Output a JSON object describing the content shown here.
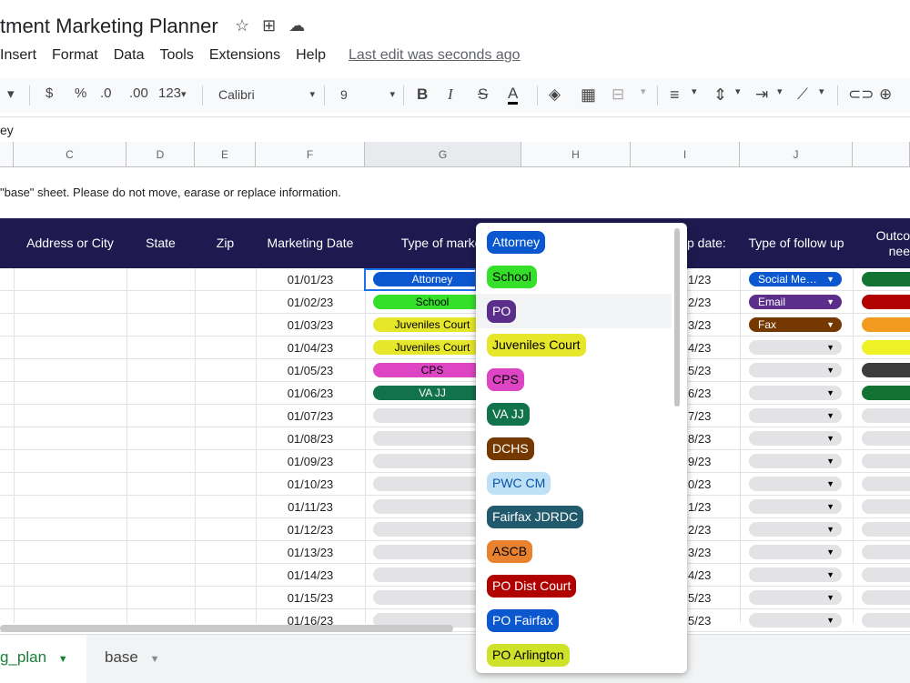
{
  "app": {
    "title": "tment Marketing Planner",
    "menus": [
      "Insert",
      "Format",
      "Data",
      "Tools",
      "Extensions",
      "Help"
    ],
    "last_edit": "Last edit was seconds ago"
  },
  "toolbar": {
    "currency": "$",
    "percent": "%",
    "dec_less": ".0",
    "dec_more": ".00",
    "num_format": "123",
    "font": "Calibri",
    "font_size": "9",
    "bold": "B",
    "italic": "I",
    "strike": "S",
    "text_color": "A"
  },
  "formula_bar": {
    "content": "ey"
  },
  "columns": [
    "C",
    "D",
    "E",
    "F",
    "G",
    "H",
    "I",
    "J"
  ],
  "note": "\"base\" sheet. Please do not move, earase or replace information.",
  "headers": {
    "address": "Address or City",
    "state": "State",
    "zip": "Zip",
    "marketing_date": "Marketing Date",
    "type_market": "Type of market",
    "followup_date": "p date:",
    "type_followup": "Type of follow up",
    "outcome_1": "Outco",
    "outcome_2": "nee"
  },
  "rows": [
    {
      "date": "01/01/23",
      "type": "Attorney",
      "type_color": "#0b57d0",
      "type_text": "#ffffff",
      "fdate": "1/23",
      "follow": "Social Me…",
      "follow_color": "#0b57d0",
      "follow_text": "#ffffff",
      "outcome_color": "#137333"
    },
    {
      "date": "01/02/23",
      "type": "School",
      "type_color": "#35e02a",
      "type_text": "#000000",
      "fdate": "2/23",
      "follow": "Email",
      "follow_color": "#5b2e8c",
      "follow_text": "#ffffff",
      "outcome_color": "#b10202"
    },
    {
      "date": "01/03/23",
      "type": "Juveniles Court",
      "type_color": "#e6e62a",
      "type_text": "#000000",
      "fdate": "3/23",
      "follow": "Fax",
      "follow_color": "#753800",
      "follow_text": "#ffffff",
      "outcome_color": "#f29b1f"
    },
    {
      "date": "01/04/23",
      "type": "Juveniles Court",
      "type_color": "#e6e62a",
      "type_text": "#000000",
      "fdate": "4/23",
      "follow": "",
      "follow_color": "#e3e3e6",
      "follow_text": "#000000",
      "outcome_color": "#eef226"
    },
    {
      "date": "01/05/23",
      "type": "CPS",
      "type_color": "#dd45c4",
      "type_text": "#000000",
      "fdate": "5/23",
      "follow": "",
      "follow_color": "#e3e3e6",
      "follow_text": "#000000",
      "outcome_color": "#3c3c3c"
    },
    {
      "date": "01/06/23",
      "type": "VA JJ",
      "type_color": "#11734b",
      "type_text": "#ffffff",
      "fdate": "6/23",
      "follow": "",
      "follow_color": "#e3e3e6",
      "follow_text": "#000000",
      "outcome_color": "#137333"
    },
    {
      "date": "01/07/23",
      "type": "",
      "type_color": "#e3e3e6",
      "type_text": "#000000",
      "fdate": "7/23",
      "follow": "",
      "follow_color": "#e3e3e6",
      "follow_text": "#000000",
      "outcome_color": "#e3e3e6"
    },
    {
      "date": "01/08/23",
      "type": "",
      "type_color": "#e3e3e6",
      "type_text": "#000000",
      "fdate": "8/23",
      "follow": "",
      "follow_color": "#e3e3e6",
      "follow_text": "#000000",
      "outcome_color": "#e3e3e6"
    },
    {
      "date": "01/09/23",
      "type": "",
      "type_color": "#e3e3e6",
      "type_text": "#000000",
      "fdate": "9/23",
      "follow": "",
      "follow_color": "#e3e3e6",
      "follow_text": "#000000",
      "outcome_color": "#e3e3e6"
    },
    {
      "date": "01/10/23",
      "type": "",
      "type_color": "#e3e3e6",
      "type_text": "#000000",
      "fdate": "0/23",
      "follow": "",
      "follow_color": "#e3e3e6",
      "follow_text": "#000000",
      "outcome_color": "#e3e3e6"
    },
    {
      "date": "01/11/23",
      "type": "",
      "type_color": "#e3e3e6",
      "type_text": "#000000",
      "fdate": "1/23",
      "follow": "",
      "follow_color": "#e3e3e6",
      "follow_text": "#000000",
      "outcome_color": "#e3e3e6"
    },
    {
      "date": "01/12/23",
      "type": "",
      "type_color": "#e3e3e6",
      "type_text": "#000000",
      "fdate": "2/23",
      "follow": "",
      "follow_color": "#e3e3e6",
      "follow_text": "#000000",
      "outcome_color": "#e3e3e6"
    },
    {
      "date": "01/13/23",
      "type": "",
      "type_color": "#e3e3e6",
      "type_text": "#000000",
      "fdate": "3/23",
      "follow": "",
      "follow_color": "#e3e3e6",
      "follow_text": "#000000",
      "outcome_color": "#e3e3e6"
    },
    {
      "date": "01/14/23",
      "type": "",
      "type_color": "#e3e3e6",
      "type_text": "#000000",
      "fdate": "4/23",
      "follow": "",
      "follow_color": "#e3e3e6",
      "follow_text": "#000000",
      "outcome_color": "#e3e3e6"
    },
    {
      "date": "01/15/23",
      "type": "",
      "type_color": "#e3e3e6",
      "type_text": "#000000",
      "fdate": "5/23",
      "follow": "",
      "follow_color": "#e3e3e6",
      "follow_text": "#000000",
      "outcome_color": "#e3e3e6"
    },
    {
      "date": "01/16/23",
      "type": "",
      "type_color": "#e3e3e6",
      "type_text": "#000000",
      "fdate": "5/23",
      "follow": "",
      "follow_color": "#e3e3e6",
      "follow_text": "#000000",
      "outcome_color": "#e3e3e6"
    }
  ],
  "dropdown": {
    "options": [
      {
        "label": "Attorney",
        "bg": "#0b57d0",
        "fg": "#ffffff"
      },
      {
        "label": "School",
        "bg": "#35e02a",
        "fg": "#000000"
      },
      {
        "label": "PO",
        "bg": "#5b2e8c",
        "fg": "#ffffff"
      },
      {
        "label": "Juveniles Court",
        "bg": "#e6e62a",
        "fg": "#000000"
      },
      {
        "label": "CPS",
        "bg": "#dd45c4",
        "fg": "#000000"
      },
      {
        "label": "VA JJ",
        "bg": "#11734b",
        "fg": "#ffffff"
      },
      {
        "label": "DCHS",
        "bg": "#753800",
        "fg": "#ffffff"
      },
      {
        "label": "PWC CM",
        "bg": "#bfe1f6",
        "fg": "#0a53a8"
      },
      {
        "label": "Fairfax JDRDC",
        "bg": "#215a6c",
        "fg": "#ffffff"
      },
      {
        "label": "ASCB",
        "bg": "#e8822e",
        "fg": "#000000"
      },
      {
        "label": "PO Dist Court",
        "bg": "#b10202",
        "fg": "#ffffff"
      },
      {
        "label": "PO Fairfax",
        "bg": "#0b57d0",
        "fg": "#ffffff"
      },
      {
        "label": "PO Arlington",
        "bg": "#cfe22a",
        "fg": "#000000"
      }
    ]
  },
  "sheet_tabs": {
    "active": "g_plan",
    "other": "base"
  }
}
